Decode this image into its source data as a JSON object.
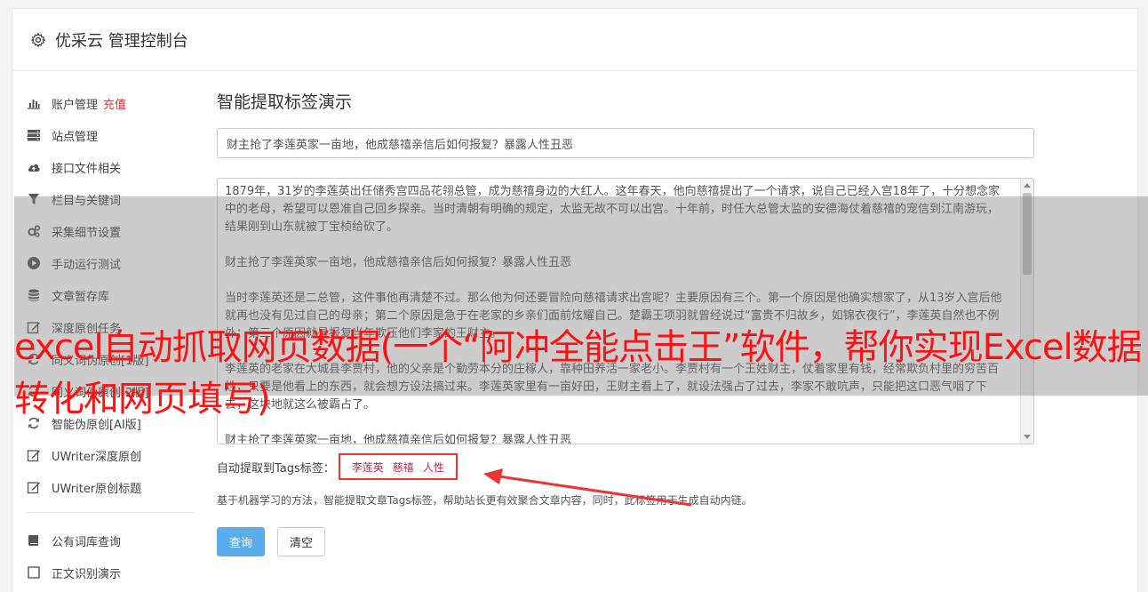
{
  "header": {
    "title": "优采云 管理控制台",
    "icon": "gear-icon"
  },
  "sidebar": {
    "items": [
      {
        "label": "账户管理",
        "icon": "bar-chart-icon",
        "extra": "充值"
      },
      {
        "label": "站点管理",
        "icon": "server-icon"
      },
      {
        "label": "接口文件相关",
        "icon": "cloud-upload-icon"
      },
      {
        "label": "栏目与关键词",
        "icon": "filter-icon"
      },
      {
        "label": "采集细节设置",
        "icon": "gears-icon"
      },
      {
        "label": "手动运行测试",
        "icon": "play-circle-icon"
      },
      {
        "label": "文章暂存库",
        "icon": "database-icon"
      },
      {
        "label": "深度原创任务",
        "icon": "edit-icon"
      },
      {
        "label": "同义词伪原创[1版]",
        "icon": "refresh-icon"
      },
      {
        "label": "同义词伪原创[2版]",
        "icon": "refresh-icon"
      },
      {
        "label": "智能伪原创[AI版]",
        "icon": "refresh-icon"
      },
      {
        "label": "UWriter深度原创",
        "icon": "edit-icon"
      },
      {
        "label": "UWriter原创标题",
        "icon": "edit-icon"
      }
    ],
    "items2": [
      {
        "label": "公有词库查询",
        "icon": "book-icon"
      },
      {
        "label": "正文识别演示",
        "icon": "square-icon"
      }
    ]
  },
  "main": {
    "heading": "智能提取标签演示",
    "title_value": "财主抢了李莲英家一亩地，他成慈禧亲信后如何报复？暴露人性丑恶",
    "paragraphs": [
      "1879年，31岁的李莲英出任储秀宫四品花翎总管，成为慈禧身边的大红人。这年春天，他向慈禧提出了一个请求，说自己已经入宫18年了，十分想念家中的老母，希望可以恩准自己回乡探亲。当时清朝有明确的规定，太监无故不可以出宫。十年前，时任大总管太监的安德海仗着慈禧的宠信到江南游玩，结果刚到山东就被丁宝桢给砍了。",
      "财主抢了李莲英家一亩地，他成慈禧亲信后如何报复？暴露人性丑恶",
      "当时李莲英还是二总管，这件事他再清楚不过。那么他为何还要冒险向慈禧请求出宫呢？主要原因有三个。第一个原因是他确实想家了，从13岁入宫后他就再也没有见过自己的母亲；第二个原因是急于在老家的乡亲们面前炫耀自己。楚霸王项羽就曾经说过“富贵不归故乡，如锦衣夜行”，李莲英自然也不例外；第三个原因就是报复当年欺压他们李家的王财主。",
      "李莲英的老家在大城县李贾村，他的父亲是个勤劳本分的庄稼人，靠种田养活一家老小。李贾村有一个王姓财主，仗着家里有钱，经常欺负村里的穷苦百姓，只要是他看上的东西，就会想方设法搞过来。李莲英家里有一亩好田，王财主看上了，就设法强占了过去，李家不敢吭声，只能把这口恶气咽了下去，这块地就这么被霸占了。",
      "财主抢了李莲英家一亩地，他成慈禧亲信后如何报复？暴露人性丑恶"
    ],
    "tags_label": "自动提取到Tags标签：",
    "tags": [
      "李莲英",
      "慈禧",
      "人性"
    ],
    "description": "基于机器学习的方法，智能提取文章Tags标签，帮助站长更有效聚合文章内容，同时，此标签用于生成自动内链。",
    "query_button": "查询",
    "clear_button": "清空"
  },
  "overlay": {
    "title": "excel自动抓取网页数据(一个“阿冲全能点击王”软件，帮你实现Excel数据转化和网页填写)"
  },
  "colors": {
    "accent": "#5aaceb",
    "highlight": "#e33333",
    "overlay_text": "#ff1111"
  }
}
